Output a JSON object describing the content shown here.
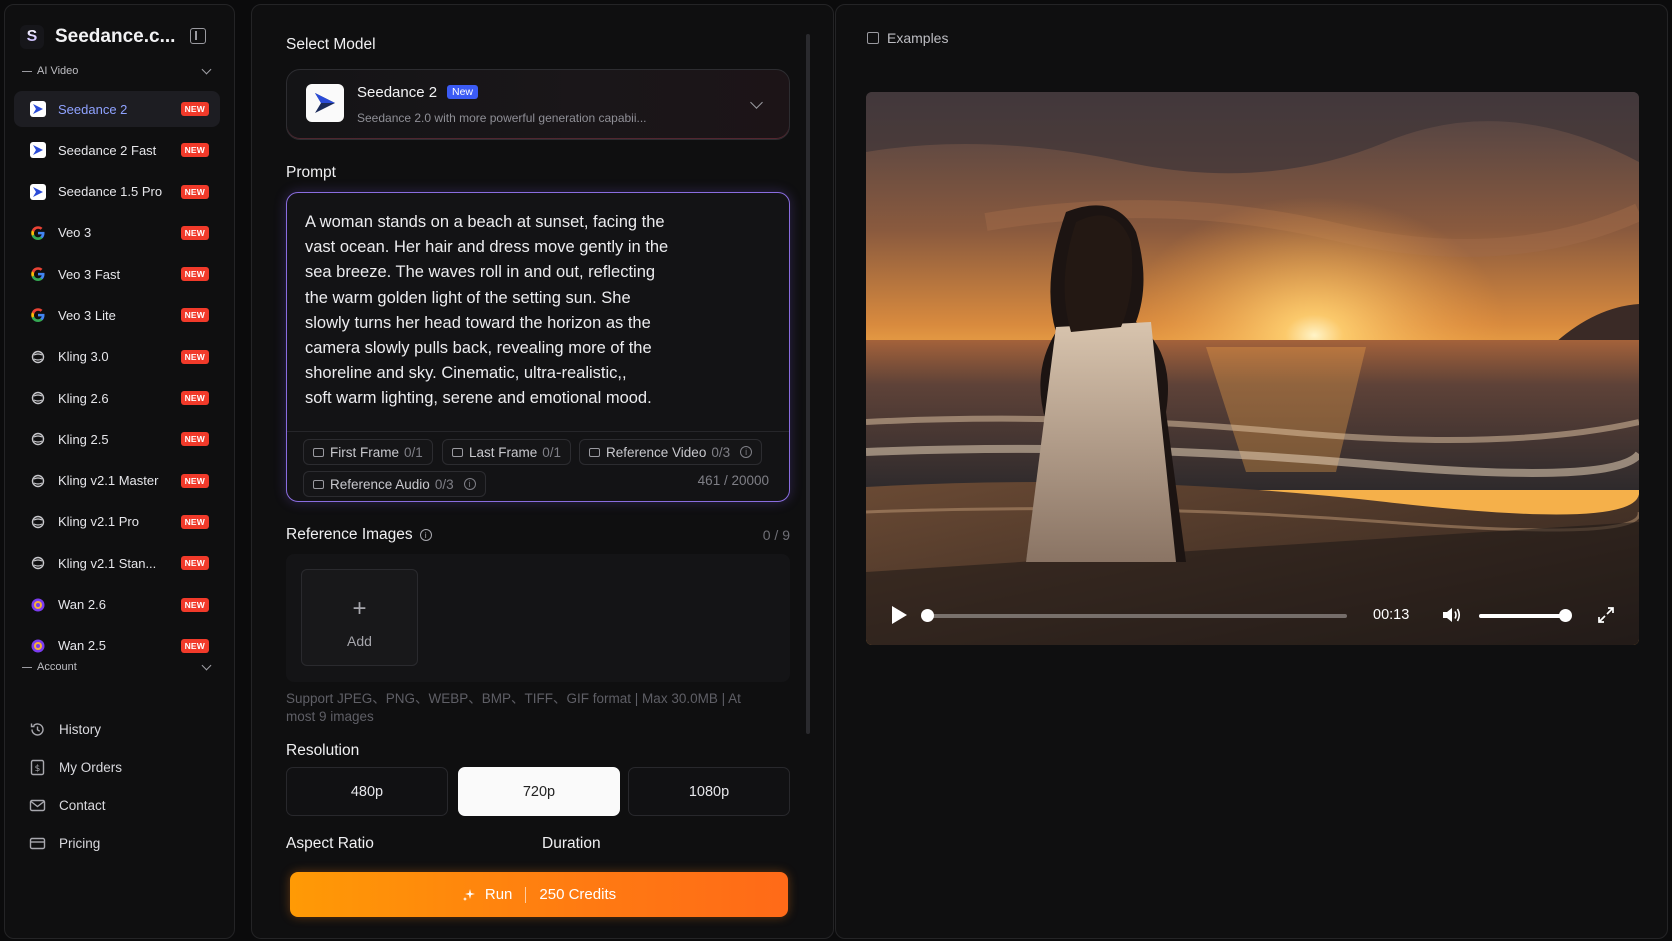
{
  "brand": {
    "name": "Seedance.c...",
    "logo_letter": "S"
  },
  "sidebar": {
    "ai_video_label": "AI Video",
    "models": [
      {
        "label": "Seedance 2",
        "icon": "seedance-icon",
        "badge": "NEW",
        "active": true
      },
      {
        "label": "Seedance 2 Fast",
        "icon": "seedance-icon",
        "badge": "NEW",
        "active": false
      },
      {
        "label": "Seedance 1.5 Pro",
        "icon": "seedance-icon",
        "badge": "NEW",
        "active": false
      },
      {
        "label": "Veo 3",
        "icon": "google-icon",
        "badge": "NEW",
        "active": false
      },
      {
        "label": "Veo 3 Fast",
        "icon": "google-icon",
        "badge": "NEW",
        "active": false
      },
      {
        "label": "Veo 3 Lite",
        "icon": "google-icon",
        "badge": "NEW",
        "active": false
      },
      {
        "label": "Kling 3.0",
        "icon": "kling-icon",
        "badge": "NEW",
        "active": false
      },
      {
        "label": "Kling 2.6",
        "icon": "kling-icon",
        "badge": "NEW",
        "active": false
      },
      {
        "label": "Kling 2.5",
        "icon": "kling-icon",
        "badge": "NEW",
        "active": false
      },
      {
        "label": "Kling v2.1 Master",
        "icon": "kling-icon",
        "badge": "NEW",
        "active": false
      },
      {
        "label": "Kling v2.1 Pro",
        "icon": "kling-icon",
        "badge": "NEW",
        "active": false
      },
      {
        "label": "Kling v2.1 Stan...",
        "icon": "kling-icon",
        "badge": "NEW",
        "active": false
      },
      {
        "label": "Wan 2.6",
        "icon": "wan-icon",
        "badge": "NEW",
        "active": false
      },
      {
        "label": "Wan 2.5",
        "icon": "wan-icon",
        "badge": "NEW",
        "active": false
      }
    ],
    "account_label": "Account",
    "account_items": [
      {
        "label": "History",
        "icon": "history-icon"
      },
      {
        "label": "My Orders",
        "icon": "orders-icon"
      },
      {
        "label": "Contact",
        "icon": "mail-icon"
      },
      {
        "label": "Pricing",
        "icon": "card-icon"
      }
    ]
  },
  "form": {
    "select_model_label": "Select Model",
    "model": {
      "name": "Seedance 2",
      "tag": "New",
      "description": "Seedance 2.0 with more powerful generation capabii..."
    },
    "prompt_label": "Prompt",
    "prompt_text": "A woman stands on a beach at sunset, facing the\nvast ocean. Her hair and dress move gently in the\nsea breeze. The waves roll in and out, reflecting\nthe warm golden light of the setting sun. She\nslowly turns her head toward the horizon as the\ncamera slowly pulls back, revealing more of the\nshoreline and sky. Cinematic, ultra-realistic,,\nsoft warm lighting, serene and emotional mood.",
    "attachments": {
      "first_frame": {
        "label": "First Frame",
        "count": "0/1"
      },
      "last_frame": {
        "label": "Last Frame",
        "count": "0/1"
      },
      "reference_video": {
        "label": "Reference Video",
        "count": "0/3"
      },
      "reference_audio": {
        "label": "Reference Audio",
        "count": "0/3"
      }
    },
    "char_count": "461 / 20000",
    "reference_images": {
      "label": "Reference Images",
      "counter": "0 / 9",
      "add_label": "Add",
      "add_symbol": "+",
      "support_text": "Support JPEG、PNG、WEBP、BMP、TIFF、GIF format | Max 30.0MB | At most 9 images"
    },
    "resolution_label": "Resolution",
    "resolutions": [
      {
        "label": "480p",
        "selected": false
      },
      {
        "label": "720p",
        "selected": true
      },
      {
        "label": "1080p",
        "selected": false
      }
    ],
    "aspect_ratio_label": "Aspect Ratio",
    "duration_label": "Duration",
    "run": {
      "label": "Run",
      "credits": "250 Credits"
    }
  },
  "examples": {
    "title": "Examples",
    "player": {
      "time": "00:13",
      "progress": 0.0,
      "volume": 0.95
    }
  },
  "colors": {
    "accent_blue": "#8fa2ff",
    "badge_red": "#f13a2a",
    "run_orange": "#ff8a10",
    "prompt_border": "#8a6de0",
    "tag_blue": "#3b5bf5"
  }
}
